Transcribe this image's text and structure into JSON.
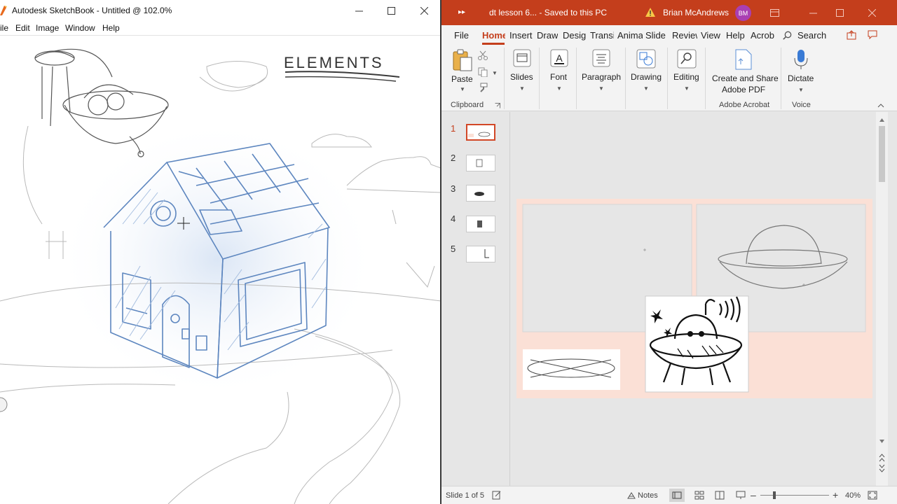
{
  "sketchbook": {
    "title": "Autodesk SketchBook - Untitled @ 102.0%",
    "menu": [
      "ile",
      "Edit",
      "Image",
      "Window",
      "Help"
    ],
    "canvas_heading": "ELEMENTS"
  },
  "powerpoint": {
    "title": "dt lesson 6...  -  Saved to this PC",
    "user_name": "Brian McAndrews",
    "user_initials": "BM",
    "tabs": [
      "File",
      "Home",
      "Insert",
      "Draw",
      "Desig",
      "Transi",
      "Anima",
      "Slide",
      "Review",
      "View",
      "Help",
      "Acrob"
    ],
    "search_label": "Search",
    "ribbon": {
      "paste": "Paste",
      "clipboard": "Clipboard",
      "slides": "Slides",
      "font": "Font",
      "paragraph": "Paragraph",
      "drawing": "Drawing",
      "editing": "Editing",
      "create_pdf_line1": "Create and Share",
      "create_pdf_line2": "Adobe PDF",
      "adobe_group": "Adobe Acrobat",
      "dictate": "Dictate",
      "voice_group": "Voice"
    },
    "thumbnails": [
      "1",
      "2",
      "3",
      "4",
      "5"
    ],
    "status": {
      "slide_info": "Slide 1 of 5",
      "notes": "Notes",
      "zoom": "40%"
    }
  },
  "colors": {
    "ppt_accent": "#c43e1c",
    "slide_bg": "#fbe0d6",
    "sketch_blue": "#5d86bf"
  }
}
